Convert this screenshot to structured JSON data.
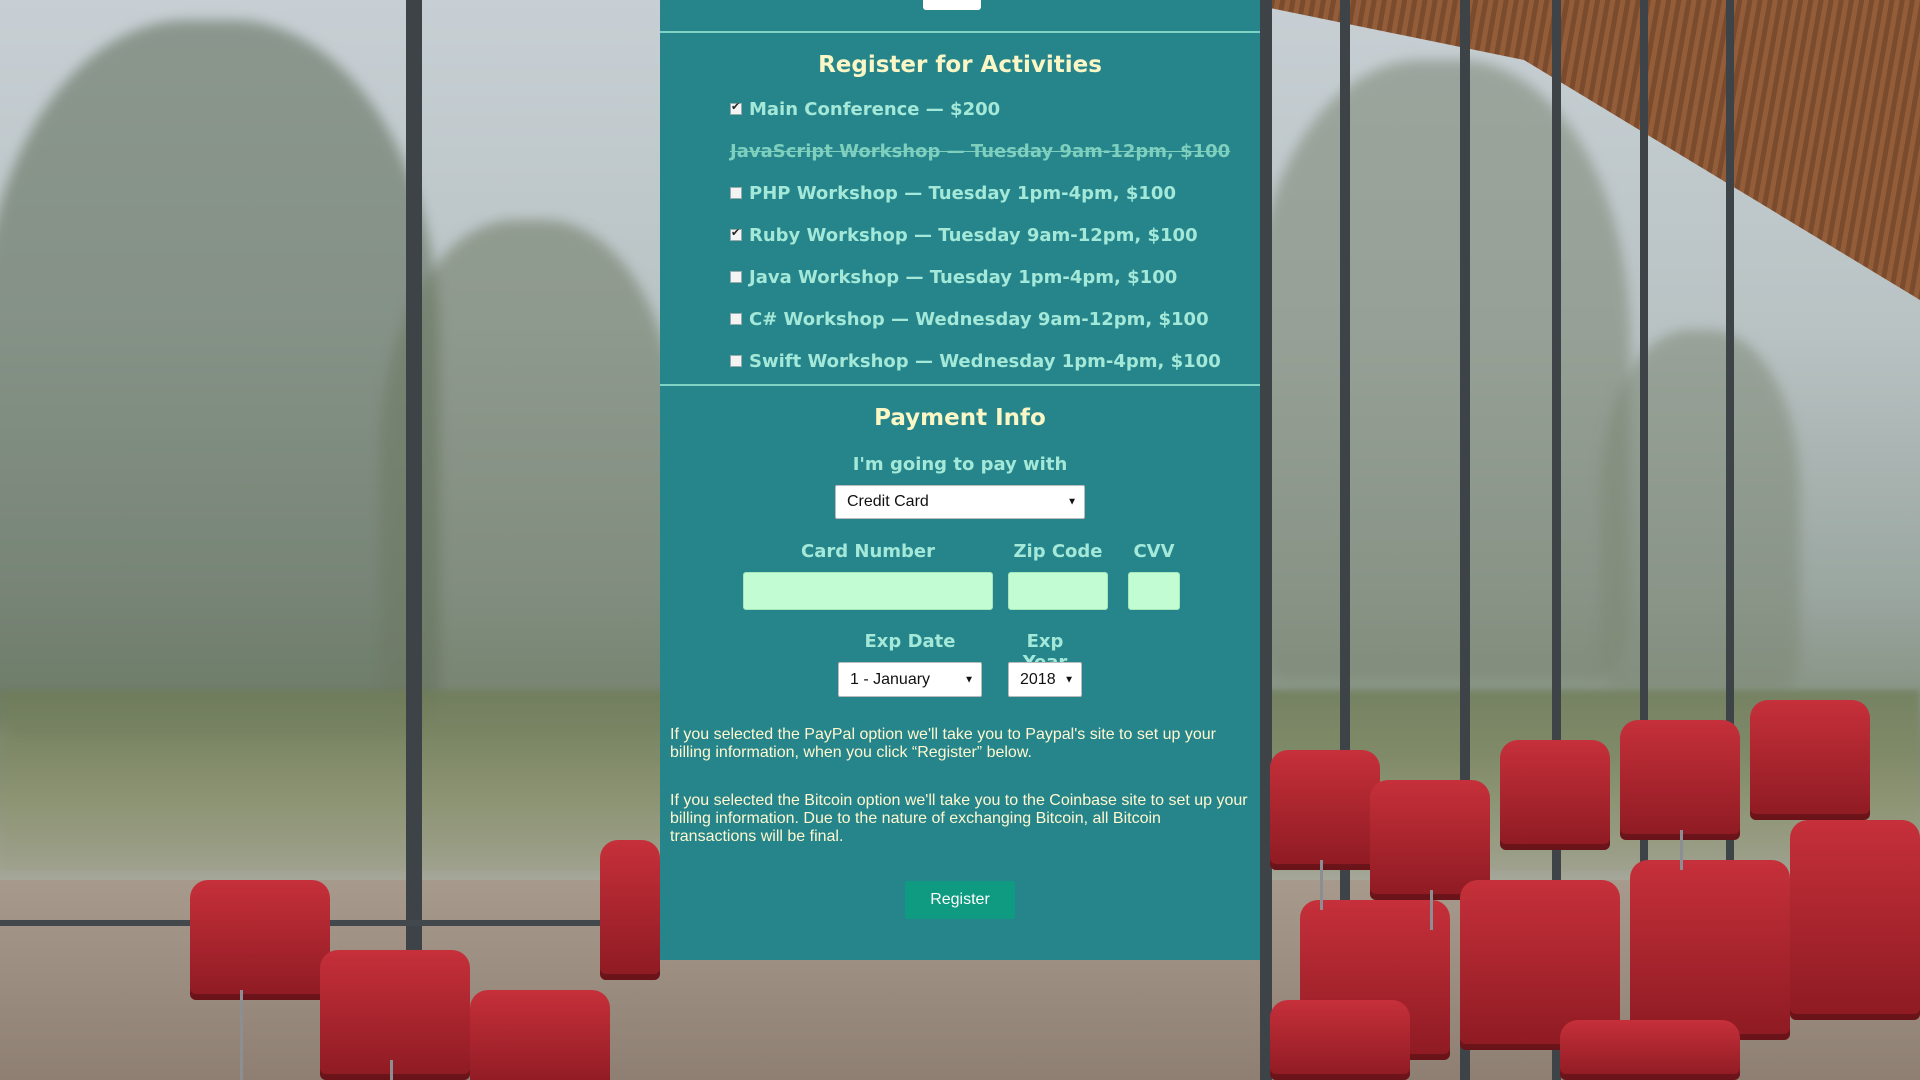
{
  "activities": {
    "title": "Register for Activities",
    "items": [
      {
        "label": "Main Conference — $200",
        "checked": true,
        "disabled": false
      },
      {
        "label": "JavaScript Workshop — Tuesday 9am-12pm, $100",
        "checked": false,
        "disabled": true
      },
      {
        "label": "PHP Workshop — Tuesday 1pm-4pm, $100",
        "checked": false,
        "disabled": false
      },
      {
        "label": "Ruby Workshop — Tuesday 9am-12pm, $100",
        "checked": true,
        "disabled": false
      },
      {
        "label": "Java Workshop — Tuesday 1pm-4pm, $100",
        "checked": false,
        "disabled": false
      },
      {
        "label": "C# Workshop — Wednesday 9am-12pm, $100",
        "checked": false,
        "disabled": false
      },
      {
        "label": "Swift Workshop — Wednesday 1pm-4pm, $100",
        "checked": false,
        "disabled": false
      }
    ]
  },
  "payment": {
    "title": "Payment Info",
    "method_label": "I'm going to pay with",
    "method_value": "Credit Card",
    "card_number_label": "Card Number",
    "zip_label": "Zip Code",
    "cvv_label": "CVV",
    "exp_date_label": "Exp Date",
    "exp_date_value": "1 - January",
    "exp_year_label": "Exp Year",
    "exp_year_value": "2018",
    "paypal_note": "If you selected the PayPal option we'll take you to Paypal's site to set up your billing information, when you click “Register” below.",
    "bitcoin_note": "If you selected the Bitcoin option we'll take you to the Coinbase site to set up your billing information. Due to the nature of exchanging Bitcoin, all Bitcoin transactions will be final.",
    "register_label": "Register"
  },
  "colors": {
    "panel_bg": "#25858a",
    "heading_text": "#fbf6c5",
    "label_text": "#a3e8d8",
    "input_bg": "#c1fcd3",
    "button_bg": "#0f9b82"
  },
  "icons": {
    "checkbox": "checkbox-icon",
    "select_arrow": "dropdown-arrow-icon"
  }
}
